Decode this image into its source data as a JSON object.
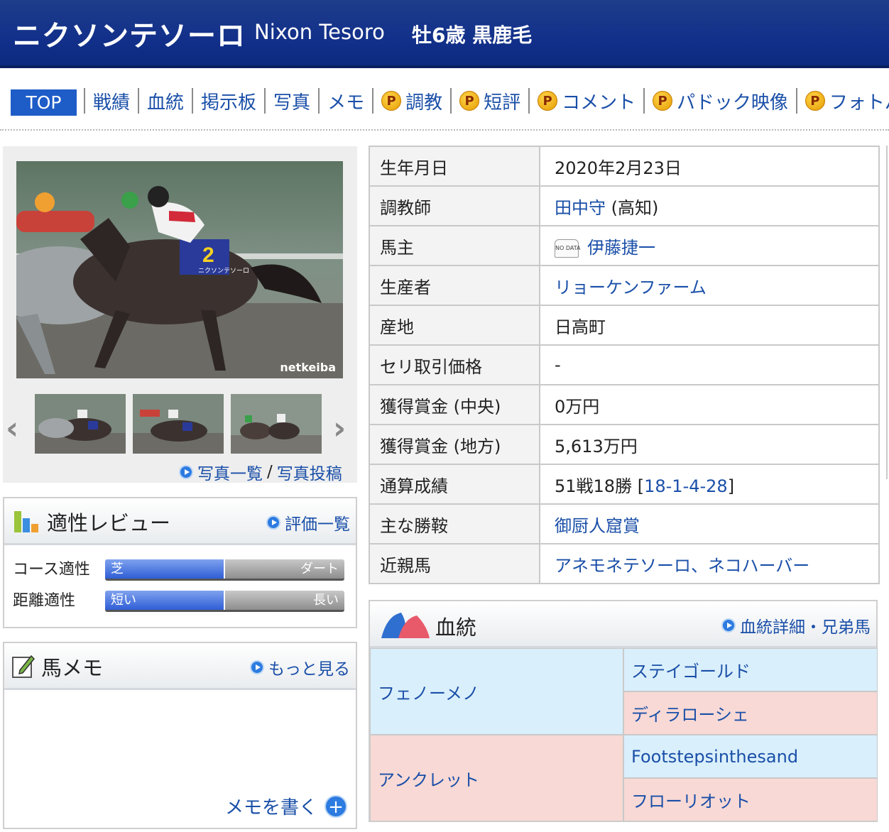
{
  "header": {
    "name_ja": "ニクソンテソーロ",
    "name_en": "Nixon Tesoro",
    "attributes": "牡6歳 黒鹿毛"
  },
  "tabs": {
    "top": "TOP",
    "items": [
      {
        "label": "戦績",
        "premium": false
      },
      {
        "label": "血統",
        "premium": false
      },
      {
        "label": "掲示板",
        "premium": false
      },
      {
        "label": "写真",
        "premium": false
      },
      {
        "label": "メモ",
        "premium": false
      },
      {
        "label": "調教",
        "premium": true
      },
      {
        "label": "短評",
        "premium": true
      },
      {
        "label": "コメント",
        "premium": true
      },
      {
        "label": "パドック映像",
        "premium": true
      },
      {
        "label": "フォトパ",
        "premium": true
      }
    ],
    "premium_icon": "P"
  },
  "photo": {
    "credit": "netkeiba",
    "number_cloth": "2",
    "saddle_name": "ニクソンテソーロ",
    "links": {
      "list": "写真一覧",
      "sep": "/",
      "post": "写真投稿"
    }
  },
  "review": {
    "title": "適性レビュー",
    "more": "評価一覧",
    "rows": [
      {
        "label": "コース適性",
        "left": "芝",
        "right": "ダート",
        "level": 0.5
      },
      {
        "label": "距離適性",
        "left": "短い",
        "right": "長い",
        "level": 0.5
      }
    ]
  },
  "memo": {
    "title": "馬メモ",
    "more": "もっと見る",
    "write": "メモを書く"
  },
  "profile": {
    "birthdate_label": "生年月日",
    "birthdate": "2020年2月23日",
    "trainer_label": "調教師",
    "trainer": "田中守",
    "trainer_region": "(高知)",
    "owner_label": "馬主",
    "owner": "伊藤捷一",
    "silk_text": "NO DATA",
    "breeder_label": "生産者",
    "breeder": "リョーケンファーム",
    "origin_label": "産地",
    "origin": "日高町",
    "auction_label": "セリ取引価格",
    "auction": "-",
    "earnings_central_label": "獲得賞金 (中央)",
    "earnings_central": "0万円",
    "earnings_local_label": "獲得賞金 (地方)",
    "earnings_local": "5,613万円",
    "record_label": "通算成績",
    "record_text": "51戦18勝",
    "record_detail": "18-1-4-28",
    "bracket_open": "[",
    "bracket_close": "]",
    "wins_label": "主な勝鞍",
    "wins": "御厨人窟賞",
    "relatives_label": "近親馬",
    "relatives": "アネモネテソーロ、ネコハーバー"
  },
  "pedigree": {
    "title": "血統",
    "more": "血統詳細・兄弟馬",
    "sire": "フェノーメノ",
    "sire_sire": "ステイゴールド",
    "sire_dam": "ディラローシェ",
    "dam": "アンクレット",
    "dam_sire": "Footstepsinthesand",
    "dam_dam": "フローリオット"
  },
  "colors": {
    "header_bg": "#12308a",
    "link": "#1a4fa8",
    "tab_active": "#1e5cc8",
    "pedigree_male": "#d9effb",
    "pedigree_female": "#f8d9d5"
  }
}
